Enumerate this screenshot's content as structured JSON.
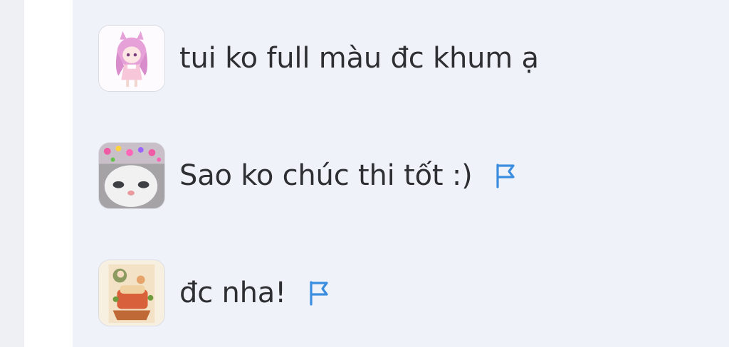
{
  "thread": {
    "replies": [
      {
        "avatar_icon": "anime-girl-avatar-icon",
        "text": "tui ko full màu đc khum ạ",
        "has_report_flag": false
      },
      {
        "avatar_icon": "cat-hearts-avatar-icon",
        "text": "Sao ko chúc thi tốt :)",
        "has_report_flag": true
      },
      {
        "avatar_icon": "illustrated-character-avatar-icon",
        "text": "đc nha!",
        "has_report_flag": true
      }
    ]
  },
  "colors": {
    "panel_background": "#eff3f9",
    "text": "#2d2f33",
    "flag": "#3b8de0"
  }
}
